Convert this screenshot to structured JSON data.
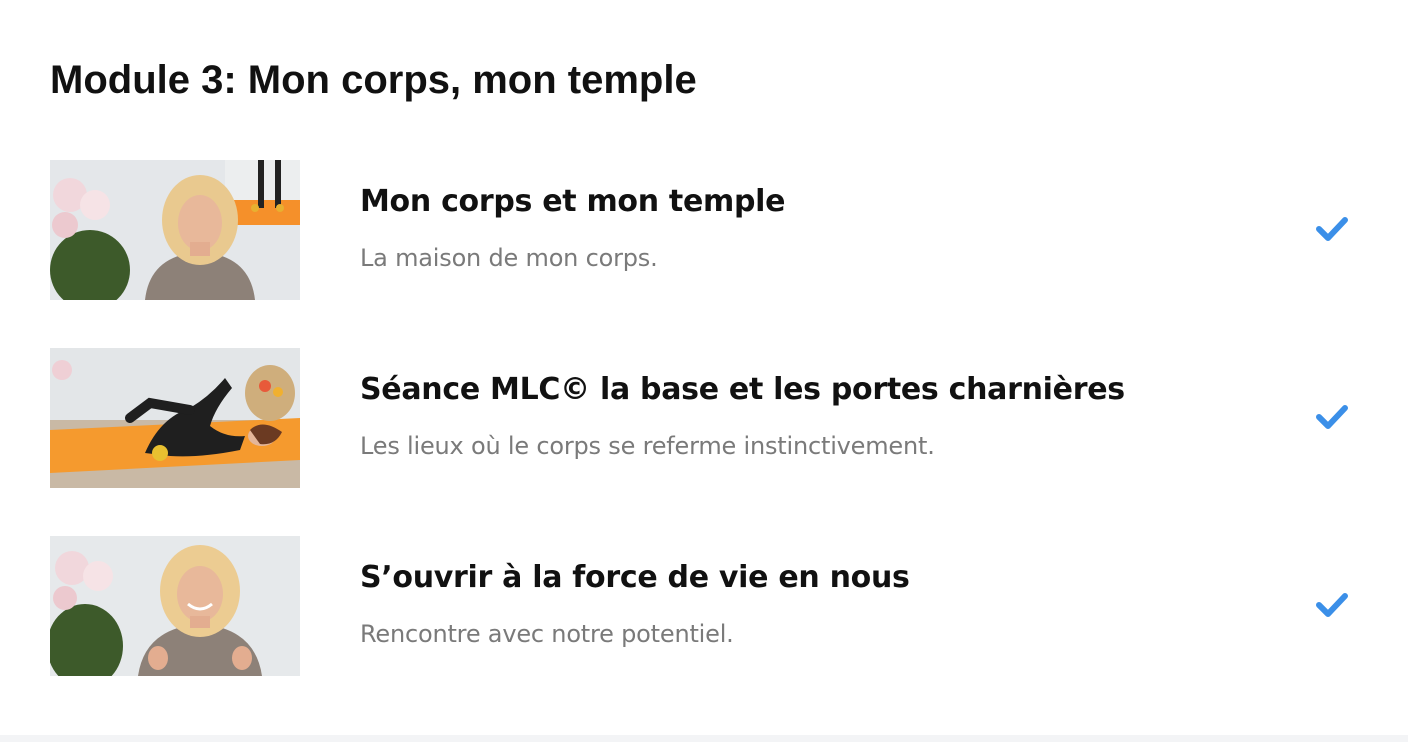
{
  "module": {
    "title": "Module 3: Mon corps, mon temple"
  },
  "lessons": [
    {
      "title": "Mon corps et mon temple",
      "description": "La maison de mon corps.",
      "completed": true,
      "thumbnail": "woman-speaking-with-roses"
    },
    {
      "title": "Séance MLC© la base et les portes charnières",
      "description": "Les lieux où le corps se referme instinctivement.",
      "completed": true,
      "thumbnail": "woman-lying-on-orange-mat"
    },
    {
      "title": "S’ouvrir à la force de vie en nous",
      "description": "Rencontre avec notre potentiel.",
      "completed": true,
      "thumbnail": "woman-smiling-with-roses"
    }
  ],
  "colors": {
    "check": "#3b8fe8",
    "title": "#111111",
    "description": "#7a7a7a"
  },
  "icons": {
    "completed": "checkmark-icon"
  }
}
